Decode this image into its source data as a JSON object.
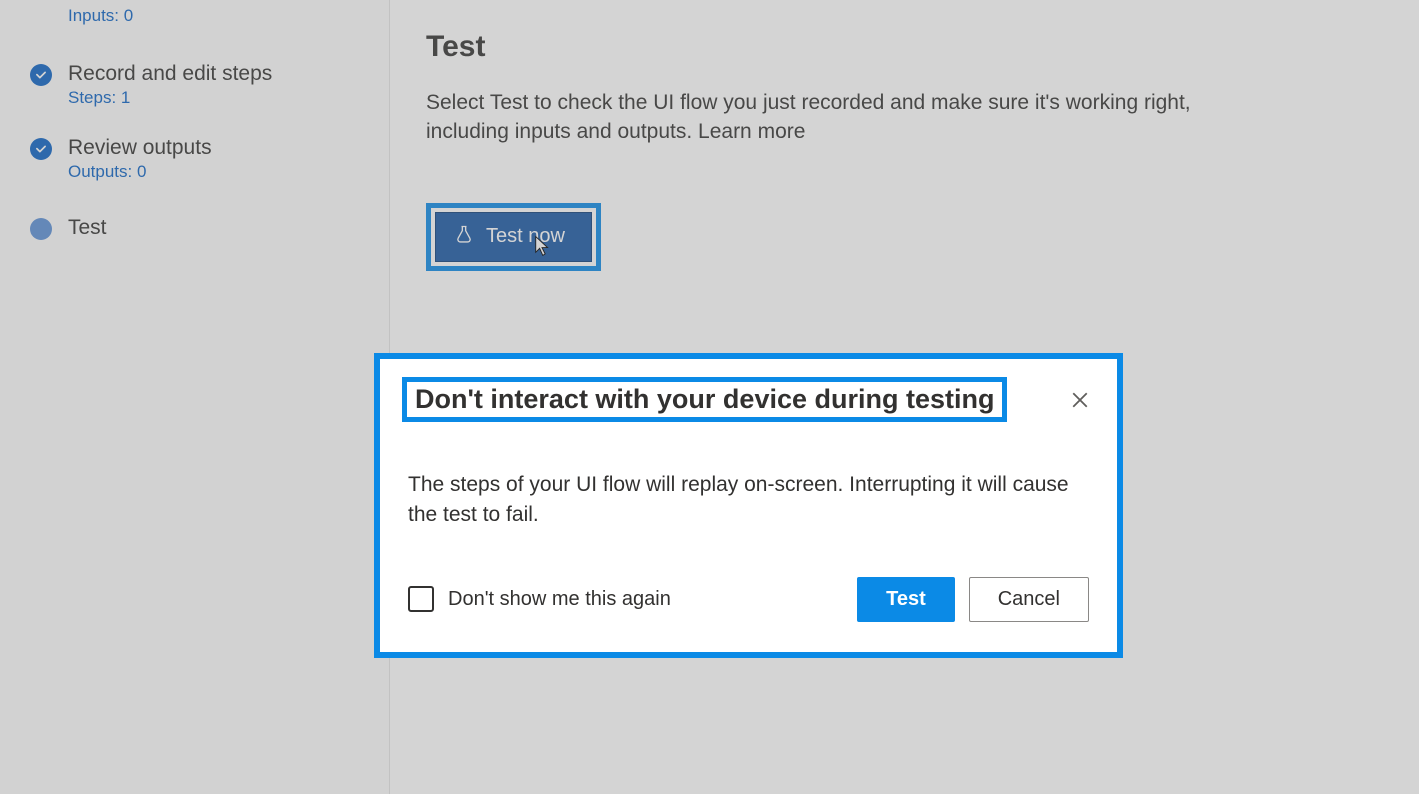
{
  "sidebar": {
    "steps": [
      {
        "title": "",
        "sub": "Inputs: 0",
        "state": "blank"
      },
      {
        "title": "Record and edit steps",
        "sub": "Steps: 1",
        "state": "done"
      },
      {
        "title": "Review outputs",
        "sub": "Outputs: 0",
        "state": "done"
      },
      {
        "title": "Test",
        "sub": "",
        "state": "current"
      }
    ]
  },
  "main": {
    "title": "Test",
    "description": "Select Test to check the UI flow you just recorded and make sure it's working right, including inputs and outputs. ",
    "learn_more": "Learn more",
    "test_now_label": "Test now"
  },
  "dialog": {
    "title": "Don't interact with your device during testing",
    "body": "The steps of your UI flow will replay on-screen. Interrupting it will cause the test to fail.",
    "dont_show_label": "Don't show me this again",
    "test_label": "Test",
    "cancel_label": "Cancel"
  },
  "colors": {
    "accent": "#0b8ae6",
    "primary_button": "#1857a4"
  }
}
